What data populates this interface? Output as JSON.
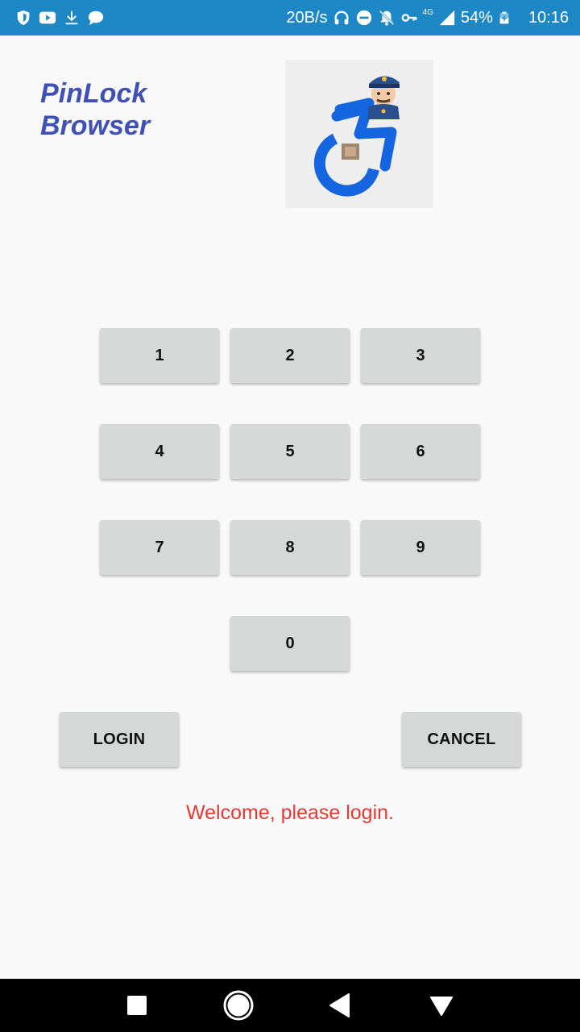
{
  "status_bar": {
    "speed": "20B/s",
    "network": "4G",
    "battery": "54%",
    "time": "10:16",
    "icons": [
      "shield-icon",
      "youtube-icon",
      "download-icon",
      "chat-icon",
      "headphones-icon",
      "dnd-icon",
      "mute-notifications-icon",
      "key-icon",
      "signal-icon",
      "battery-icon"
    ]
  },
  "app": {
    "title_line1": "PinLock",
    "title_line2": "Browser",
    "logo": "accessibility-police-logo"
  },
  "keypad": {
    "keys": [
      "1",
      "2",
      "3",
      "4",
      "5",
      "6",
      "7",
      "8",
      "9",
      "0"
    ]
  },
  "actions": {
    "login_label": "LOGIN",
    "cancel_label": "CANCEL"
  },
  "message": {
    "text": "Welcome, please login.",
    "color": "#e53935"
  },
  "nav_bar": {
    "buttons": [
      "recents-icon",
      "home-icon",
      "back-icon",
      "notifications-dropdown-icon"
    ]
  },
  "colors": {
    "status_bar": "#1e88c7",
    "title": "#3f51b5",
    "key_bg": "#d6d7d7",
    "background": "#f9f9f9"
  }
}
